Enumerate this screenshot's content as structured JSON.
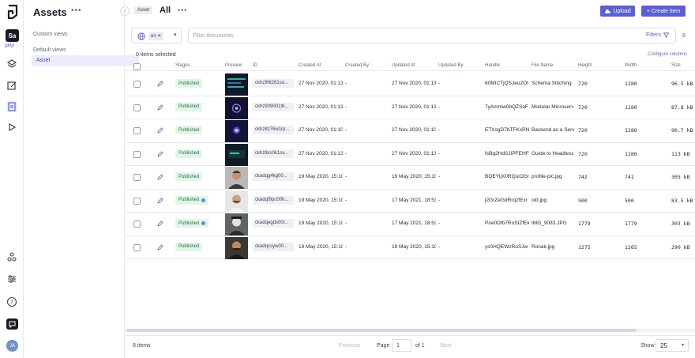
{
  "rail": {
    "project_initials": "Sa",
    "env_label": "M",
    "avatar_initials": "JA"
  },
  "views": {
    "title": "Assets",
    "title_more": "•••",
    "collapse_glyph": "‹",
    "custom_label": "Custom views",
    "default_label": "Default views",
    "active_view": "Asset"
  },
  "header": {
    "model_tag": "Asset",
    "view_name": "All",
    "more": "•••",
    "upload_label": "Upload",
    "create_label": "+ Create item"
  },
  "filter": {
    "locale_chip": "en ✕",
    "locale_chevron": "▾",
    "search_placeholder": "Filter documents",
    "filters_label": "Filters",
    "count_link": "8"
  },
  "selection": {
    "selected_text": "0 items selected",
    "configure_label": "Configure columns"
  },
  "table": {
    "columns": [
      "Stages",
      "Preview",
      "ID",
      "Created At",
      "Created By",
      "Updated At",
      "Updated By",
      "Handle",
      "File Name",
      "Height",
      "Width",
      "Size"
    ],
    "rows": [
      {
        "stage": "Published",
        "dot": false,
        "id": "ckhz90t281so...",
        "created": "27 Nov 2020, 01:13",
        "created_by": "-",
        "updated": "27 Nov 2020, 01:13",
        "updated_by": "-",
        "handle": "60MICTjQSJeu2OI",
        "file": "Schema Stitching",
        "height": "720",
        "width": "1280",
        "size": "96.5 kB"
      },
      {
        "stage": "Published",
        "dot": false,
        "id": "ckhz909001t8...",
        "created": "27 Nov 2020, 01:13",
        "created_by": "-",
        "updated": "27 Nov 2020, 01:13",
        "updated_by": "-",
        "handle": "7yAmmw0bQZSoF",
        "file": "Modular Microserv",
        "height": "720",
        "width": "1280",
        "size": "87.8 kB"
      },
      {
        "stage": "Published",
        "dot": false,
        "id": "ckhz8z76w1rp...",
        "created": "27 Nov 2020, 01:10",
        "created_by": "-",
        "updated": "27 Nov 2020, 01:10",
        "updated_by": "-",
        "handle": "ETXsgD7bTFKxRN",
        "file": "Backend as a Serv",
        "height": "720",
        "width": "1280",
        "size": "90.7 kB"
      },
      {
        "stage": "Published",
        "dot": false,
        "id": "ckhz8xs0k1sv...",
        "created": "27 Nov 2020, 01:13",
        "created_by": "-",
        "updated": "27 Nov 2020, 01:13",
        "updated_by": "-",
        "handle": "fsBg2HdSJIPFEHF",
        "file": "Guide to Headless",
        "height": "720",
        "width": "1280",
        "size": "113 kB"
      },
      {
        "stage": "Published",
        "dot": false,
        "id": "ckadqg4kg00...",
        "created": "19 May 2020, 15:10",
        "created_by": "-",
        "updated": "19 May 2020, 15:10",
        "updated_by": "-",
        "handle": "BQEYljX0RQuiOGr",
        "file": "profile-pic.jpg",
        "height": "742",
        "width": "741",
        "size": "305 kB"
      },
      {
        "stage": "Published",
        "dot": true,
        "id": "ckadqf9pc00h...",
        "created": "19 May 2020, 15:10",
        "created_by": "-",
        "updated": "17 May 2021, 18:53",
        "updated_by": "-",
        "handle": "j2GrZeGdRrqzfExr",
        "file": "old.jpg",
        "height": "500",
        "width": "500",
        "size": "83.5 kB"
      },
      {
        "stage": "Published",
        "dot": true,
        "id": "ckadqegds00i...",
        "created": "19 May 2020, 15:10",
        "created_by": "-",
        "updated": "17 May 2021, 18:53",
        "updated_by": "-",
        "handle": "Poe0Dtb7RoSIZfEk",
        "file": "IMG_9083.JPG",
        "height": "1779",
        "width": "1779",
        "size": "303 kB"
      },
      {
        "stage": "Published",
        "dot": false,
        "id": "ckadqcsyw00...",
        "created": "19 May 2020, 15:10",
        "created_by": "-",
        "updated": "19 May 2020, 15:10",
        "updated_by": "-",
        "handle": "ys0HQEWzRuSJw",
        "file": "Ronak.jpg",
        "height": "1275",
        "width": "1265",
        "size": "290 kB"
      }
    ]
  },
  "footer": {
    "items": "8 items",
    "previous": "Previous",
    "page_label": "Page",
    "page_value": "1",
    "of_label": "of 1",
    "next": "Next",
    "show_label": "Show",
    "show_value": "25",
    "show_chevron": "▾"
  },
  "colors": {
    "accent": "#5b5fd7",
    "published_bg": "#e3f5e9",
    "published_fg": "#1b7a41"
  }
}
